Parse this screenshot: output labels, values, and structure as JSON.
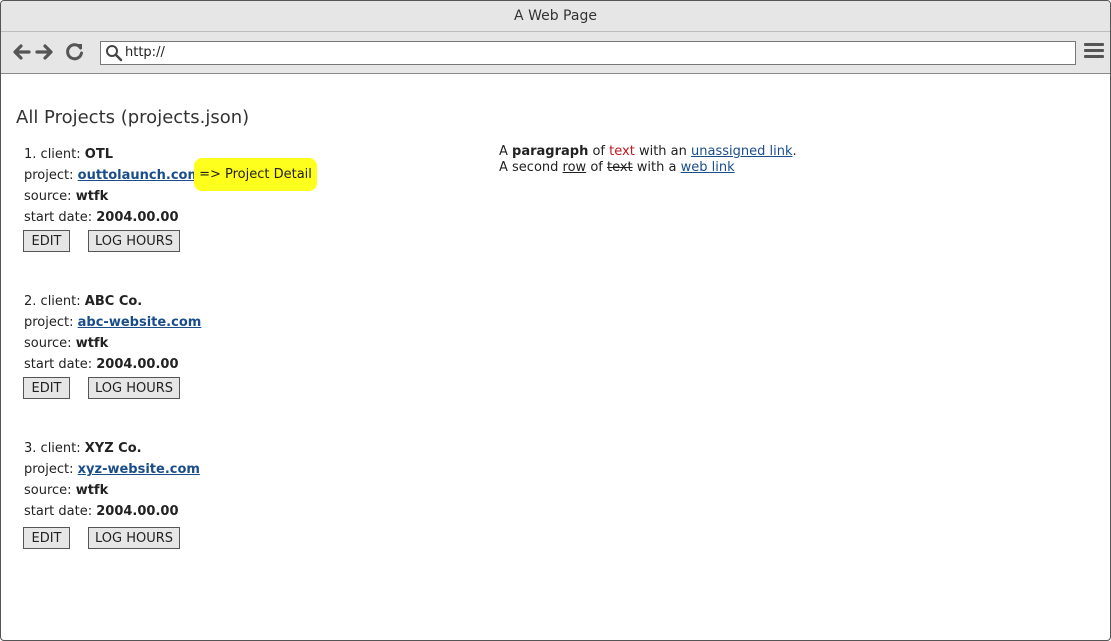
{
  "window": {
    "title": "A Web Page"
  },
  "toolbar": {
    "url": "http://",
    "back_icon": "arrow-left-icon",
    "forward_icon": "arrow-right-icon",
    "reload_icon": "reload-icon",
    "menu_icon": "hamburger-menu-icon"
  },
  "page": {
    "title": "All Projects (projects.json)",
    "labels": {
      "client": "client:",
      "project": "project:",
      "source": "source:",
      "start_date": "start date:"
    },
    "buttons": {
      "edit": "EDIT",
      "log_hours": "LOG HOURS"
    },
    "projects": [
      {
        "num": "1.",
        "client": "OTL",
        "project": "outtolaunch.com",
        "source": "wtfk",
        "start_date": "2004.00.00"
      },
      {
        "num": "2.",
        "client": "ABC Co.",
        "project": "abc-website.com",
        "source": "wtfk",
        "start_date": "2004.00.00"
      },
      {
        "num": "3.",
        "client": "XYZ Co.",
        "project": "xyz-website.com",
        "source": "wtfk",
        "start_date": "2004.00.00"
      }
    ],
    "highlight": "=> Project Detail",
    "paragraph": {
      "line1": [
        "A ",
        "paragraph",
        " of ",
        "text",
        " with an ",
        "unassigned link",
        "."
      ],
      "line2": [
        "A second ",
        "row",
        " of ",
        "text",
        " with a ",
        "web link"
      ]
    }
  },
  "colors": {
    "highlight": "#ffff1e",
    "link": "#1a4e8a",
    "red_text": "#c0181c"
  }
}
